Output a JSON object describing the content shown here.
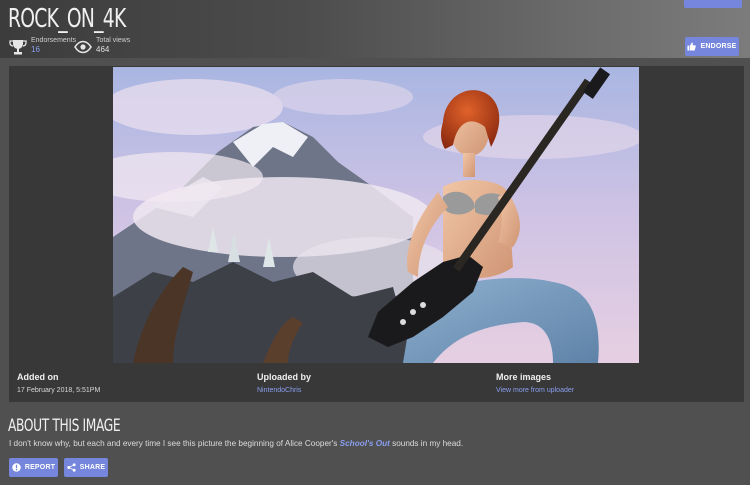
{
  "page": {
    "title": "ROCK_ON_4K",
    "stats": {
      "endorsements_label": "Endorsements",
      "endorsements_value": "16",
      "views_label": "Total views",
      "views_value": "464"
    },
    "endorse_label": "ENDORSE"
  },
  "image": {
    "subject": "red-haired woman playing electric guitar on a snowy mountain"
  },
  "meta": {
    "added_label": "Added on",
    "added_value": "17 February 2018,  5:51PM",
    "uploader_label": "Uploaded by",
    "uploader_value": "NintendoChris",
    "more_label": "More images",
    "more_link": "View more from uploader"
  },
  "about": {
    "title": "ABOUT THIS IMAGE",
    "desc_before": "I don't know why, but each and every time I see this picture the beginning of Alice Cooper's ",
    "desc_song": "School's Out",
    "desc_after": "  sounds in my head."
  },
  "actions": {
    "report_label": "REPORT",
    "share_label": "SHARE"
  },
  "colors": {
    "accent": "#7586dc",
    "link": "#8a9ff0",
    "background": "#505050",
    "panel": "#383838"
  }
}
